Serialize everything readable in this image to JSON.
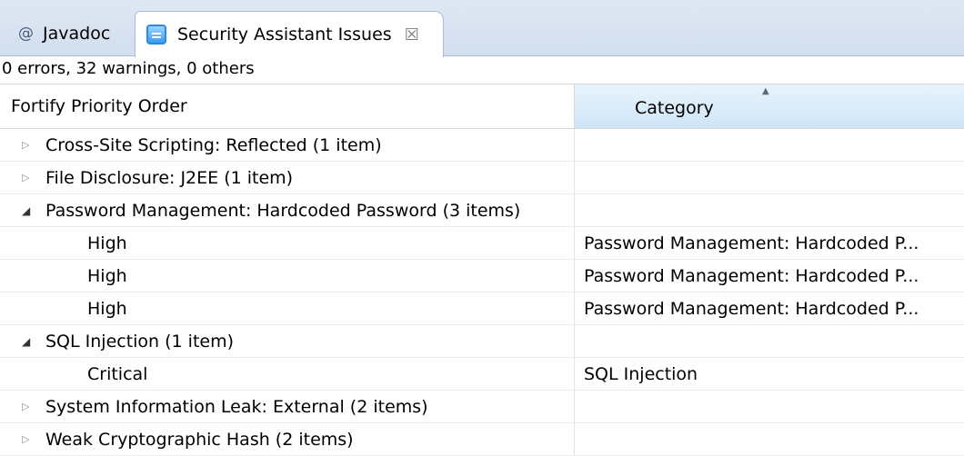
{
  "tabs": [
    {
      "label": "Javadoc",
      "icon": "at-icon",
      "glyph": "@"
    },
    {
      "label": "Security Assistant Issues",
      "icon": "issues-view-icon",
      "close_glyph": "☒"
    }
  ],
  "status": "0 errors, 32 warnings, 0 others",
  "columns": {
    "priority": "Fortify Priority Order",
    "category": "Category",
    "sort_glyph": "▲"
  },
  "rows": [
    {
      "label": "Cross-Site Scripting: Reflected (1 item)",
      "category": "",
      "expanded": false
    },
    {
      "label": "File Disclosure: J2EE (1 item)",
      "category": "",
      "expanded": false
    },
    {
      "label": "Password Management: Hardcoded Password (3 items)",
      "category": "",
      "expanded": true,
      "children": [
        {
          "label": "High",
          "category": "Password Management: Hardcoded P..."
        },
        {
          "label": "High",
          "category": "Password Management: Hardcoded P..."
        },
        {
          "label": "High",
          "category": "Password Management: Hardcoded P..."
        }
      ]
    },
    {
      "label": "SQL Injection (1 item)",
      "category": "",
      "expanded": true,
      "children": [
        {
          "label": "Critical",
          "category": "SQL Injection"
        }
      ]
    },
    {
      "label": "System Information Leak: External (2 items)",
      "category": "",
      "expanded": false
    },
    {
      "label": "Weak Cryptographic Hash (2 items)",
      "category": "",
      "expanded": false
    }
  ],
  "glyphs": {
    "collapsed": "▷",
    "expanded": "◢"
  }
}
